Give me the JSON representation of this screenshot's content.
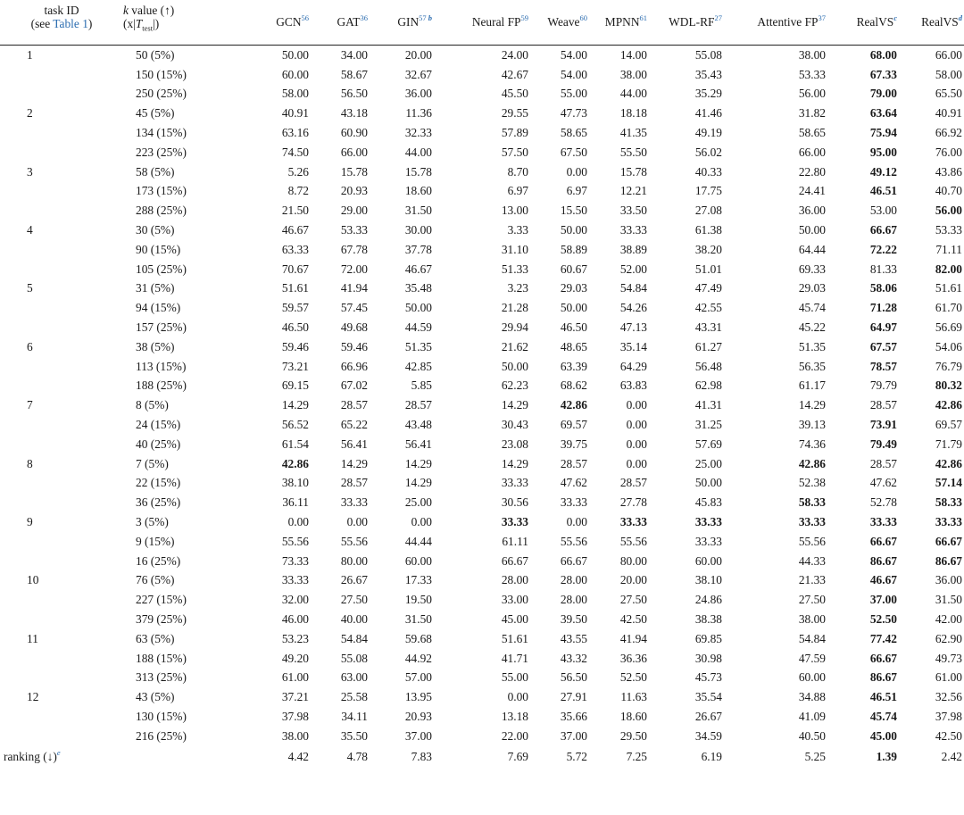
{
  "header": {
    "task_line1": "task ID",
    "task_line2_pre": "(see ",
    "task_line2_link": "Table 1",
    "task_line2_post": ")",
    "k_line1_var": "k",
    "k_line1_rest": " value (↑)",
    "k_line2_pre": "(x|",
    "k_line2_var": "T",
    "k_line2_sub": "test",
    "k_line2_post": "|)",
    "columns": [
      {
        "label": "GCN",
        "sup": "56",
        "sup2": ""
      },
      {
        "label": "GAT",
        "sup": "36",
        "sup2": ""
      },
      {
        "label": "GIN",
        "sup": "57",
        "sup2": "b"
      },
      {
        "label": "Neural FP",
        "sup": "59",
        "sup2": ""
      },
      {
        "label": "Weave",
        "sup": "60",
        "sup2": ""
      },
      {
        "label": "MPNN",
        "sup": "61",
        "sup2": ""
      },
      {
        "label": "WDL-RF",
        "sup": "27",
        "sup2": ""
      },
      {
        "label": "Attentive FP",
        "sup": "37",
        "sup2": ""
      },
      {
        "label": "RealVS",
        "sup": "",
        "sup2": "c"
      },
      {
        "label": "RealVS",
        "sup": "",
        "sup2": "d"
      }
    ]
  },
  "rows": [
    {
      "task": "1",
      "k": "50 (5%)",
      "values": [
        "50.00",
        "34.00",
        "20.00",
        "24.00",
        "54.00",
        "14.00",
        "55.08",
        "38.00",
        "68.00",
        "66.00"
      ],
      "bold": [
        8
      ]
    },
    {
      "task": "",
      "k": "150 (15%)",
      "values": [
        "60.00",
        "58.67",
        "32.67",
        "42.67",
        "54.00",
        "38.00",
        "35.43",
        "53.33",
        "67.33",
        "58.00"
      ],
      "bold": [
        8
      ]
    },
    {
      "task": "",
      "k": "250 (25%)",
      "values": [
        "58.00",
        "56.50",
        "36.00",
        "45.50",
        "55.00",
        "44.00",
        "35.29",
        "56.00",
        "79.00",
        "65.50"
      ],
      "bold": [
        8
      ]
    },
    {
      "task": "2",
      "k": "45 (5%)",
      "values": [
        "40.91",
        "43.18",
        "11.36",
        "29.55",
        "47.73",
        "18.18",
        "41.46",
        "31.82",
        "63.64",
        "40.91"
      ],
      "bold": [
        8
      ]
    },
    {
      "task": "",
      "k": "134 (15%)",
      "values": [
        "63.16",
        "60.90",
        "32.33",
        "57.89",
        "58.65",
        "41.35",
        "49.19",
        "58.65",
        "75.94",
        "66.92"
      ],
      "bold": [
        8
      ]
    },
    {
      "task": "",
      "k": "223 (25%)",
      "values": [
        "74.50",
        "66.00",
        "44.00",
        "57.50",
        "67.50",
        "55.50",
        "56.02",
        "66.00",
        "95.00",
        "76.00"
      ],
      "bold": [
        8
      ]
    },
    {
      "task": "3",
      "k": "58 (5%)",
      "values": [
        "5.26",
        "15.78",
        "15.78",
        "8.70",
        "0.00",
        "15.78",
        "40.33",
        "22.80",
        "49.12",
        "43.86"
      ],
      "bold": [
        8
      ]
    },
    {
      "task": "",
      "k": "173 (15%)",
      "values": [
        "8.72",
        "20.93",
        "18.60",
        "6.97",
        "6.97",
        "12.21",
        "17.75",
        "24.41",
        "46.51",
        "40.70"
      ],
      "bold": [
        8
      ]
    },
    {
      "task": "",
      "k": "288 (25%)",
      "values": [
        "21.50",
        "29.00",
        "31.50",
        "13.00",
        "15.50",
        "33.50",
        "27.08",
        "36.00",
        "53.00",
        "56.00"
      ],
      "bold": [
        9
      ]
    },
    {
      "task": "4",
      "k": "30 (5%)",
      "values": [
        "46.67",
        "53.33",
        "30.00",
        "3.33",
        "50.00",
        "33.33",
        "61.38",
        "50.00",
        "66.67",
        "53.33"
      ],
      "bold": [
        8
      ]
    },
    {
      "task": "",
      "k": "90 (15%)",
      "values": [
        "63.33",
        "67.78",
        "37.78",
        "31.10",
        "58.89",
        "38.89",
        "38.20",
        "64.44",
        "72.22",
        "71.11"
      ],
      "bold": [
        8
      ]
    },
    {
      "task": "",
      "k": "105 (25%)",
      "values": [
        "70.67",
        "72.00",
        "46.67",
        "51.33",
        "60.67",
        "52.00",
        "51.01",
        "69.33",
        "81.33",
        "82.00"
      ],
      "bold": [
        9
      ]
    },
    {
      "task": "5",
      "k": "31 (5%)",
      "values": [
        "51.61",
        "41.94",
        "35.48",
        "3.23",
        "29.03",
        "54.84",
        "47.49",
        "29.03",
        "58.06",
        "51.61"
      ],
      "bold": [
        8
      ]
    },
    {
      "task": "",
      "k": "94 (15%)",
      "values": [
        "59.57",
        "57.45",
        "50.00",
        "21.28",
        "50.00",
        "54.26",
        "42.55",
        "45.74",
        "71.28",
        "61.70"
      ],
      "bold": [
        8
      ]
    },
    {
      "task": "",
      "k": "157 (25%)",
      "values": [
        "46.50",
        "49.68",
        "44.59",
        "29.94",
        "46.50",
        "47.13",
        "43.31",
        "45.22",
        "64.97",
        "56.69"
      ],
      "bold": [
        8
      ]
    },
    {
      "task": "6",
      "k": "38 (5%)",
      "values": [
        "59.46",
        "59.46",
        "51.35",
        "21.62",
        "48.65",
        "35.14",
        "61.27",
        "51.35",
        "67.57",
        "54.06"
      ],
      "bold": [
        8
      ]
    },
    {
      "task": "",
      "k": "113 (15%)",
      "values": [
        "73.21",
        "66.96",
        "42.85",
        "50.00",
        "63.39",
        "64.29",
        "56.48",
        "56.35",
        "78.57",
        "76.79"
      ],
      "bold": [
        8
      ]
    },
    {
      "task": "",
      "k": "188 (25%)",
      "values": [
        "69.15",
        "67.02",
        "5.85",
        "62.23",
        "68.62",
        "63.83",
        "62.98",
        "61.17",
        "79.79",
        "80.32"
      ],
      "bold": [
        9
      ]
    },
    {
      "task": "7",
      "k": "8 (5%)",
      "values": [
        "14.29",
        "28.57",
        "28.57",
        "14.29",
        "42.86",
        "0.00",
        "41.31",
        "14.29",
        "28.57",
        "42.86"
      ],
      "bold": [
        4,
        9
      ]
    },
    {
      "task": "",
      "k": "24 (15%)",
      "values": [
        "56.52",
        "65.22",
        "43.48",
        "30.43",
        "69.57",
        "0.00",
        "31.25",
        "39.13",
        "73.91",
        "69.57"
      ],
      "bold": [
        8
      ]
    },
    {
      "task": "",
      "k": "40 (25%)",
      "values": [
        "61.54",
        "56.41",
        "56.41",
        "23.08",
        "39.75",
        "0.00",
        "57.69",
        "74.36",
        "79.49",
        "71.79"
      ],
      "bold": [
        8
      ]
    },
    {
      "task": "8",
      "k": "7 (5%)",
      "values": [
        "42.86",
        "14.29",
        "14.29",
        "14.29",
        "28.57",
        "0.00",
        "25.00",
        "42.86",
        "28.57",
        "42.86"
      ],
      "bold": [
        0,
        7,
        9
      ]
    },
    {
      "task": "",
      "k": "22 (15%)",
      "values": [
        "38.10",
        "28.57",
        "14.29",
        "33.33",
        "47.62",
        "28.57",
        "50.00",
        "52.38",
        "47.62",
        "57.14"
      ],
      "bold": [
        9
      ]
    },
    {
      "task": "",
      "k": "36 (25%)",
      "values": [
        "36.11",
        "33.33",
        "25.00",
        "30.56",
        "33.33",
        "27.78",
        "45.83",
        "58.33",
        "52.78",
        "58.33"
      ],
      "bold": [
        7,
        9
      ]
    },
    {
      "task": "9",
      "k": "3 (5%)",
      "values": [
        "0.00",
        "0.00",
        "0.00",
        "33.33",
        "0.00",
        "33.33",
        "33.33",
        "33.33",
        "33.33",
        "33.33"
      ],
      "bold": [
        3,
        5,
        6,
        7,
        8,
        9
      ]
    },
    {
      "task": "",
      "k": "9 (15%)",
      "values": [
        "55.56",
        "55.56",
        "44.44",
        "61.11",
        "55.56",
        "55.56",
        "33.33",
        "55.56",
        "66.67",
        "66.67"
      ],
      "bold": [
        8,
        9
      ]
    },
    {
      "task": "",
      "k": "16 (25%)",
      "values": [
        "73.33",
        "80.00",
        "60.00",
        "66.67",
        "66.67",
        "80.00",
        "60.00",
        "44.33",
        "86.67",
        "86.67"
      ],
      "bold": [
        8,
        9
      ]
    },
    {
      "task": "10",
      "k": "76 (5%)",
      "values": [
        "33.33",
        "26.67",
        "17.33",
        "28.00",
        "28.00",
        "20.00",
        "38.10",
        "21.33",
        "46.67",
        "36.00"
      ],
      "bold": [
        8
      ]
    },
    {
      "task": "",
      "k": "227 (15%)",
      "values": [
        "32.00",
        "27.50",
        "19.50",
        "33.00",
        "28.00",
        "27.50",
        "24.86",
        "27.50",
        "37.00",
        "31.50"
      ],
      "bold": [
        8
      ]
    },
    {
      "task": "",
      "k": "379 (25%)",
      "values": [
        "46.00",
        "40.00",
        "31.50",
        "45.00",
        "39.50",
        "42.50",
        "38.38",
        "38.00",
        "52.50",
        "42.00"
      ],
      "bold": [
        8
      ]
    },
    {
      "task": "11",
      "k": "63 (5%)",
      "values": [
        "53.23",
        "54.84",
        "59.68",
        "51.61",
        "43.55",
        "41.94",
        "69.85",
        "54.84",
        "77.42",
        "62.90"
      ],
      "bold": [
        8
      ]
    },
    {
      "task": "",
      "k": "188 (15%)",
      "values": [
        "49.20",
        "55.08",
        "44.92",
        "41.71",
        "43.32",
        "36.36",
        "30.98",
        "47.59",
        "66.67",
        "49.73"
      ],
      "bold": [
        8
      ]
    },
    {
      "task": "",
      "k": "313 (25%)",
      "values": [
        "61.00",
        "63.00",
        "57.00",
        "55.00",
        "56.50",
        "52.50",
        "45.73",
        "60.00",
        "86.67",
        "61.00"
      ],
      "bold": [
        8
      ]
    },
    {
      "task": "12",
      "k": "43 (5%)",
      "values": [
        "37.21",
        "25.58",
        "13.95",
        "0.00",
        "27.91",
        "11.63",
        "35.54",
        "34.88",
        "46.51",
        "32.56"
      ],
      "bold": [
        8
      ]
    },
    {
      "task": "",
      "k": "130 (15%)",
      "values": [
        "37.98",
        "34.11",
        "20.93",
        "13.18",
        "35.66",
        "18.60",
        "26.67",
        "41.09",
        "45.74",
        "37.98"
      ],
      "bold": [
        8
      ]
    },
    {
      "task": "",
      "k": "216 (25%)",
      "values": [
        "38.00",
        "35.50",
        "37.00",
        "22.00",
        "37.00",
        "29.50",
        "34.59",
        "40.50",
        "45.00",
        "42.50"
      ],
      "bold": [
        8
      ]
    }
  ],
  "ranking": {
    "label": "ranking (↓)",
    "sup": "e",
    "values": [
      "4.42",
      "4.78",
      "7.83",
      "7.69",
      "5.72",
      "7.25",
      "6.19",
      "5.25",
      "1.39",
      "2.42"
    ],
    "bold": [
      8
    ]
  }
}
